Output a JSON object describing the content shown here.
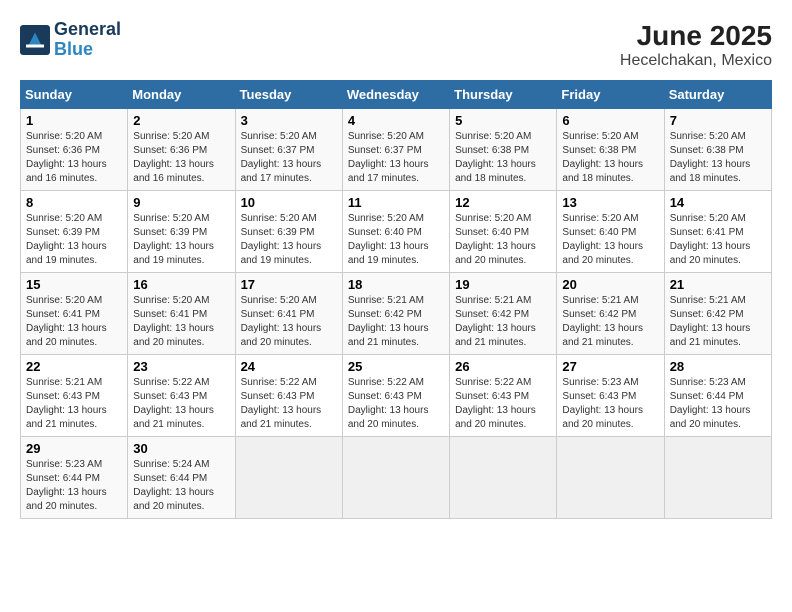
{
  "logo": {
    "line1": "General",
    "line2": "Blue"
  },
  "title": "June 2025",
  "subtitle": "Hecelchakan, Mexico",
  "days_of_week": [
    "Sunday",
    "Monday",
    "Tuesday",
    "Wednesday",
    "Thursday",
    "Friday",
    "Saturday"
  ],
  "weeks": [
    [
      {
        "day": "1",
        "detail": "Sunrise: 5:20 AM\nSunset: 6:36 PM\nDaylight: 13 hours and 16 minutes."
      },
      {
        "day": "2",
        "detail": "Sunrise: 5:20 AM\nSunset: 6:36 PM\nDaylight: 13 hours and 16 minutes."
      },
      {
        "day": "3",
        "detail": "Sunrise: 5:20 AM\nSunset: 6:37 PM\nDaylight: 13 hours and 17 minutes."
      },
      {
        "day": "4",
        "detail": "Sunrise: 5:20 AM\nSunset: 6:37 PM\nDaylight: 13 hours and 17 minutes."
      },
      {
        "day": "5",
        "detail": "Sunrise: 5:20 AM\nSunset: 6:38 PM\nDaylight: 13 hours and 18 minutes."
      },
      {
        "day": "6",
        "detail": "Sunrise: 5:20 AM\nSunset: 6:38 PM\nDaylight: 13 hours and 18 minutes."
      },
      {
        "day": "7",
        "detail": "Sunrise: 5:20 AM\nSunset: 6:38 PM\nDaylight: 13 hours and 18 minutes."
      }
    ],
    [
      {
        "day": "8",
        "detail": "Sunrise: 5:20 AM\nSunset: 6:39 PM\nDaylight: 13 hours and 19 minutes."
      },
      {
        "day": "9",
        "detail": "Sunrise: 5:20 AM\nSunset: 6:39 PM\nDaylight: 13 hours and 19 minutes."
      },
      {
        "day": "10",
        "detail": "Sunrise: 5:20 AM\nSunset: 6:39 PM\nDaylight: 13 hours and 19 minutes."
      },
      {
        "day": "11",
        "detail": "Sunrise: 5:20 AM\nSunset: 6:40 PM\nDaylight: 13 hours and 19 minutes."
      },
      {
        "day": "12",
        "detail": "Sunrise: 5:20 AM\nSunset: 6:40 PM\nDaylight: 13 hours and 20 minutes."
      },
      {
        "day": "13",
        "detail": "Sunrise: 5:20 AM\nSunset: 6:40 PM\nDaylight: 13 hours and 20 minutes."
      },
      {
        "day": "14",
        "detail": "Sunrise: 5:20 AM\nSunset: 6:41 PM\nDaylight: 13 hours and 20 minutes."
      }
    ],
    [
      {
        "day": "15",
        "detail": "Sunrise: 5:20 AM\nSunset: 6:41 PM\nDaylight: 13 hours and 20 minutes."
      },
      {
        "day": "16",
        "detail": "Sunrise: 5:20 AM\nSunset: 6:41 PM\nDaylight: 13 hours and 20 minutes."
      },
      {
        "day": "17",
        "detail": "Sunrise: 5:20 AM\nSunset: 6:41 PM\nDaylight: 13 hours and 20 minutes."
      },
      {
        "day": "18",
        "detail": "Sunrise: 5:21 AM\nSunset: 6:42 PM\nDaylight: 13 hours and 21 minutes."
      },
      {
        "day": "19",
        "detail": "Sunrise: 5:21 AM\nSunset: 6:42 PM\nDaylight: 13 hours and 21 minutes."
      },
      {
        "day": "20",
        "detail": "Sunrise: 5:21 AM\nSunset: 6:42 PM\nDaylight: 13 hours and 21 minutes."
      },
      {
        "day": "21",
        "detail": "Sunrise: 5:21 AM\nSunset: 6:42 PM\nDaylight: 13 hours and 21 minutes."
      }
    ],
    [
      {
        "day": "22",
        "detail": "Sunrise: 5:21 AM\nSunset: 6:43 PM\nDaylight: 13 hours and 21 minutes."
      },
      {
        "day": "23",
        "detail": "Sunrise: 5:22 AM\nSunset: 6:43 PM\nDaylight: 13 hours and 21 minutes."
      },
      {
        "day": "24",
        "detail": "Sunrise: 5:22 AM\nSunset: 6:43 PM\nDaylight: 13 hours and 21 minutes."
      },
      {
        "day": "25",
        "detail": "Sunrise: 5:22 AM\nSunset: 6:43 PM\nDaylight: 13 hours and 20 minutes."
      },
      {
        "day": "26",
        "detail": "Sunrise: 5:22 AM\nSunset: 6:43 PM\nDaylight: 13 hours and 20 minutes."
      },
      {
        "day": "27",
        "detail": "Sunrise: 5:23 AM\nSunset: 6:43 PM\nDaylight: 13 hours and 20 minutes."
      },
      {
        "day": "28",
        "detail": "Sunrise: 5:23 AM\nSunset: 6:44 PM\nDaylight: 13 hours and 20 minutes."
      }
    ],
    [
      {
        "day": "29",
        "detail": "Sunrise: 5:23 AM\nSunset: 6:44 PM\nDaylight: 13 hours and 20 minutes."
      },
      {
        "day": "30",
        "detail": "Sunrise: 5:24 AM\nSunset: 6:44 PM\nDaylight: 13 hours and 20 minutes."
      },
      {
        "day": "",
        "detail": ""
      },
      {
        "day": "",
        "detail": ""
      },
      {
        "day": "",
        "detail": ""
      },
      {
        "day": "",
        "detail": ""
      },
      {
        "day": "",
        "detail": ""
      }
    ]
  ]
}
